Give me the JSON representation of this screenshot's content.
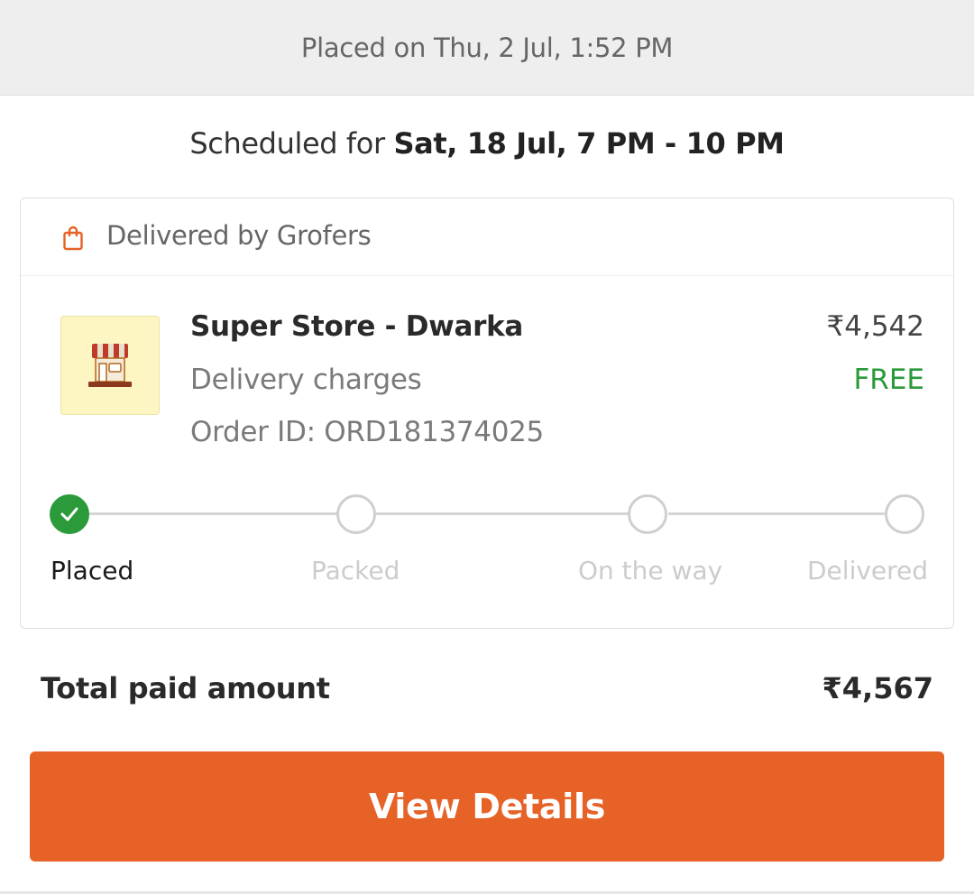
{
  "header": {
    "placed_text": "Placed on Thu, 2 Jul, 1:52 PM"
  },
  "schedule": {
    "prefix": "Scheduled for ",
    "slot": "Sat, 18 Jul, 7 PM - 10 PM"
  },
  "card": {
    "delivered_by": "Delivered by Grofers",
    "delivered_by_icon": "shopping-bag-icon",
    "store_icon": "storefront-icon",
    "store_name": "Super Store - Dwarka",
    "store_price": "₹4,542",
    "delivery_label": "Delivery charges",
    "delivery_value": "FREE",
    "order_id": "Order ID: ORD181374025",
    "steps": [
      {
        "label": "Placed",
        "state": "done"
      },
      {
        "label": "Packed",
        "state": "pending"
      },
      {
        "label": "On the way",
        "state": "pending"
      },
      {
        "label": "Delivered",
        "state": "pending"
      }
    ]
  },
  "total": {
    "label": "Total paid amount",
    "value": "₹4,567"
  },
  "actions": {
    "view_details": "View Details"
  },
  "colors": {
    "accent": "#e66226",
    "success": "#2a9a3a",
    "placed_bar_bg": "#eeeeee",
    "store_thumb_bg": "#fdf6c3"
  }
}
